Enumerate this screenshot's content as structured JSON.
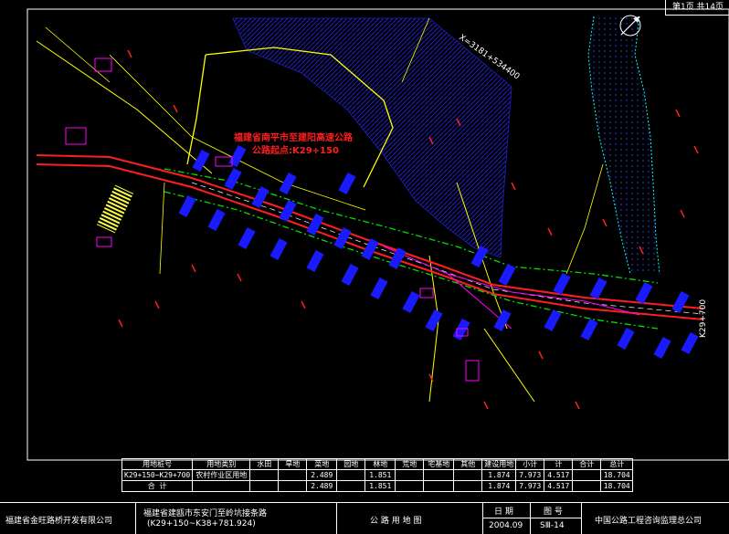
{
  "sheet": {
    "page_label": "第1页 共14页"
  },
  "labels": {
    "route_title_line1": "福建省南平市至建阳高速公路",
    "route_title_line2": "公路起点:K29+150",
    "station_end": "K29+700",
    "coord": "X=3181+534400"
  },
  "table": {
    "headers": [
      "用地桩号",
      "用地类别",
      "水田",
      "旱地",
      "菜地",
      "园地",
      "林地",
      "荒地",
      "宅基地",
      "其他",
      "建设用地",
      "小计",
      "计",
      "合计",
      "总计"
    ],
    "rows": [
      [
        "K29+150~K29+700",
        "农村作业区用地",
        "",
        "",
        "2.489",
        "",
        "1.851",
        "",
        "",
        "",
        "1.874",
        "7.973",
        "4.517",
        "",
        "18.704"
      ],
      [
        "合  计",
        "",
        "",
        "",
        "2.489",
        "",
        "1.851",
        "",
        "",
        "",
        "1.874",
        "7.973",
        "4.517",
        "",
        "18.704"
      ]
    ]
  },
  "title_block": {
    "company": "福建省金旺路桥开发有限公司",
    "project_line1": "福建省建瓯市东安门至岭坑接条路",
    "project_line2": "(K29+150~K38+781.924)",
    "drawing_name": "公 路 用 地 图",
    "date_label": "日 期",
    "date_value": "2004.09",
    "sheet_label": "图 号",
    "sheet_value": "SⅢ-14",
    "design_company": "中国公路工程咨询监理总公司"
  },
  "colors": {
    "background": "#000000",
    "road_red": "#ff1e1e",
    "boundary_green": "#00dd00",
    "land_blue": "#1a1aff",
    "hatch_blue": "#2020cc",
    "line_yellow": "#ffff00",
    "magenta": "#ff00ff",
    "cyan": "#00ffff"
  }
}
